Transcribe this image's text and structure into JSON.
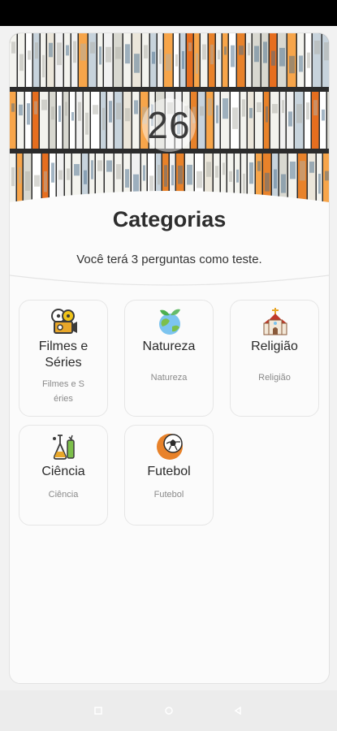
{
  "header": {
    "timer": "26",
    "title": "Categorias",
    "subtitle": "Você terá 3 perguntas como teste."
  },
  "categories": [
    {
      "name": "Filmes e Séries",
      "desc": "Filmes e Séries",
      "icon": "film-reel-icon"
    },
    {
      "name": "Natureza",
      "desc": "Natureza",
      "icon": "globe-plant-icon"
    },
    {
      "name": "Religião",
      "desc": "Religião",
      "icon": "church-icon"
    },
    {
      "name": "Ciência",
      "desc": "Ciência",
      "icon": "science-icon"
    },
    {
      "name": "Futebol",
      "desc": "Futebol",
      "icon": "soccer-ball-icon"
    }
  ],
  "nav": {
    "back_icon": "back-triangle-icon",
    "home_icon": "home-circle-icon",
    "recents_icon": "recents-square-icon"
  },
  "colors": {
    "accent_orange": "#e8822a",
    "cassette_white": "#f3f3ee"
  }
}
